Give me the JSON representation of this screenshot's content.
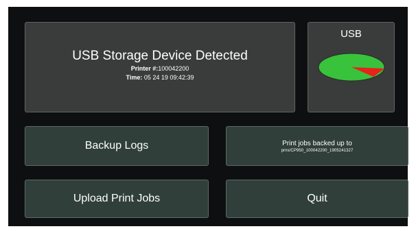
{
  "status_panel": {
    "title": "USB Storage Device Detected",
    "printer_label": "Printer #:",
    "printer_value": "100042200",
    "time_label": "Time:",
    "time_value": "05 24 19 09:42:39"
  },
  "usb_panel": {
    "label": "USB",
    "usage_graphic": {
      "used_color": "#e8211b",
      "free_color": "#39c23c",
      "used_fraction": 0.12
    }
  },
  "buttons": {
    "backup_logs": "Backup Logs",
    "upload_print_jobs": "Upload Print Jobs",
    "quit": "Quit"
  },
  "backup_info": {
    "line1": "Print jobs backed up to",
    "line2": "prns/CP950_100042200_1905241327"
  }
}
